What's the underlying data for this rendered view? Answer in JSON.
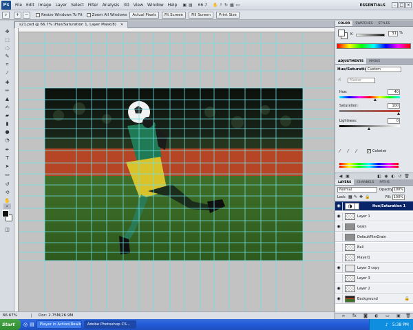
{
  "app": {
    "logo": "Ps",
    "menus": [
      "File",
      "Edit",
      "Image",
      "Layer",
      "Select",
      "Filter",
      "Analysis",
      "3D",
      "View",
      "Window",
      "Help"
    ],
    "zoom_readout": "66.7",
    "workspace": "ESSENTIALS",
    "window_controls": [
      "–",
      "□",
      "×"
    ]
  },
  "options_bar": {
    "resize_windows_label": "Resize Windows To Fit",
    "zoom_all_label": "Zoom All Windows",
    "buttons": [
      "Actual Pixels",
      "Fit Screen",
      "Fill Screen",
      "Print Size"
    ]
  },
  "document": {
    "tab_title": "s21.psd @ 66.7% (Hue/Saturation 1, Layer Mask/8)",
    "zoom": "66.67%",
    "doc_size": "Doc: 2.75M/26.9M"
  },
  "color_panel": {
    "tabs": [
      "COLOR",
      "SWATCHES",
      "STYLES"
    ],
    "channel": "K",
    "value": "31",
    "unit": "%",
    "colors": {
      "fg": "#ffffff",
      "bg": "#ffffff"
    }
  },
  "adjustments_panel": {
    "tabs": [
      "ADJUSTMENTS",
      "MASKS"
    ],
    "title": "Hue/Saturation",
    "preset": "Custom",
    "channel": "Master",
    "hue_label": "Hue:",
    "hue_value": "40",
    "saturation_label": "Saturation:",
    "saturation_value": "100",
    "lightness_label": "Lightness:",
    "lightness_value": "0",
    "colorize_label": "Colorize",
    "colorize_checked": true,
    "sliders": {
      "hue": 0.61,
      "saturation": 1.0,
      "lightness": 0.5
    }
  },
  "layers_panel": {
    "tabs": [
      "LAYERS",
      "CHANNELS",
      "PATHS"
    ],
    "blend_mode": "Normal",
    "opacity_label": "Opacity:",
    "opacity": "100%",
    "lock_label": "Lock:",
    "fill_label": "Fill:",
    "fill": "100%",
    "layers": [
      {
        "name": "Hue/Saturation 1",
        "visible": true,
        "selected": true,
        "thumb": "adjustment"
      },
      {
        "name": "Layer 1",
        "visible": true,
        "selected": false,
        "thumb": "transparent"
      },
      {
        "name": "Grain",
        "visible": true,
        "selected": false,
        "thumb": "gray"
      },
      {
        "name": "DefaultFilmGrain",
        "visible": false,
        "selected": false,
        "thumb": "gray"
      },
      {
        "name": "Ball",
        "visible": false,
        "selected": false,
        "thumb": "transparent"
      },
      {
        "name": "Player1",
        "visible": false,
        "selected": false,
        "thumb": "transparent"
      },
      {
        "name": "Layer 3 copy",
        "visible": true,
        "selected": false,
        "thumb": "player"
      },
      {
        "name": "Layer 3",
        "visible": false,
        "selected": false,
        "thumb": "transparent"
      },
      {
        "name": "Layer 2",
        "visible": true,
        "selected": false,
        "thumb": "transparent"
      },
      {
        "name": "Background",
        "visible": true,
        "selected": false,
        "thumb": "photo",
        "locked": true
      }
    ]
  },
  "taskbar": {
    "start_label": "Start",
    "tasks": [
      {
        "label": "Player in Action(Realistic...",
        "active": false
      },
      {
        "label": "Adobe Photoshop CS...",
        "active": true
      }
    ],
    "clock": "5:38 PM"
  },
  "colors": {
    "selection_blue": "#0a246a",
    "guide_cyan": "#6fe0e6",
    "taskbar_blue": "#245edb"
  }
}
